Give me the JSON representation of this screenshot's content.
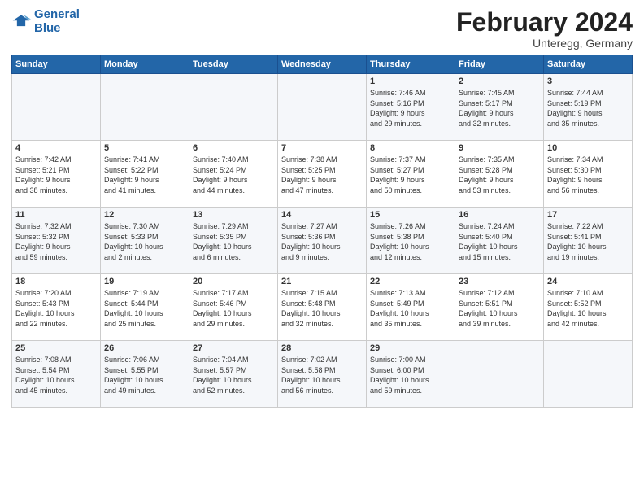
{
  "header": {
    "logo_line1": "General",
    "logo_line2": "Blue",
    "month_title": "February 2024",
    "subtitle": "Unteregg, Germany"
  },
  "days_of_week": [
    "Sunday",
    "Monday",
    "Tuesday",
    "Wednesday",
    "Thursday",
    "Friday",
    "Saturday"
  ],
  "weeks": [
    [
      {
        "day": "",
        "info": ""
      },
      {
        "day": "",
        "info": ""
      },
      {
        "day": "",
        "info": ""
      },
      {
        "day": "",
        "info": ""
      },
      {
        "day": "1",
        "info": "Sunrise: 7:46 AM\nSunset: 5:16 PM\nDaylight: 9 hours\nand 29 minutes."
      },
      {
        "day": "2",
        "info": "Sunrise: 7:45 AM\nSunset: 5:17 PM\nDaylight: 9 hours\nand 32 minutes."
      },
      {
        "day": "3",
        "info": "Sunrise: 7:44 AM\nSunset: 5:19 PM\nDaylight: 9 hours\nand 35 minutes."
      }
    ],
    [
      {
        "day": "4",
        "info": "Sunrise: 7:42 AM\nSunset: 5:21 PM\nDaylight: 9 hours\nand 38 minutes."
      },
      {
        "day": "5",
        "info": "Sunrise: 7:41 AM\nSunset: 5:22 PM\nDaylight: 9 hours\nand 41 minutes."
      },
      {
        "day": "6",
        "info": "Sunrise: 7:40 AM\nSunset: 5:24 PM\nDaylight: 9 hours\nand 44 minutes."
      },
      {
        "day": "7",
        "info": "Sunrise: 7:38 AM\nSunset: 5:25 PM\nDaylight: 9 hours\nand 47 minutes."
      },
      {
        "day": "8",
        "info": "Sunrise: 7:37 AM\nSunset: 5:27 PM\nDaylight: 9 hours\nand 50 minutes."
      },
      {
        "day": "9",
        "info": "Sunrise: 7:35 AM\nSunset: 5:28 PM\nDaylight: 9 hours\nand 53 minutes."
      },
      {
        "day": "10",
        "info": "Sunrise: 7:34 AM\nSunset: 5:30 PM\nDaylight: 9 hours\nand 56 minutes."
      }
    ],
    [
      {
        "day": "11",
        "info": "Sunrise: 7:32 AM\nSunset: 5:32 PM\nDaylight: 9 hours\nand 59 minutes."
      },
      {
        "day": "12",
        "info": "Sunrise: 7:30 AM\nSunset: 5:33 PM\nDaylight: 10 hours\nand 2 minutes."
      },
      {
        "day": "13",
        "info": "Sunrise: 7:29 AM\nSunset: 5:35 PM\nDaylight: 10 hours\nand 6 minutes."
      },
      {
        "day": "14",
        "info": "Sunrise: 7:27 AM\nSunset: 5:36 PM\nDaylight: 10 hours\nand 9 minutes."
      },
      {
        "day": "15",
        "info": "Sunrise: 7:26 AM\nSunset: 5:38 PM\nDaylight: 10 hours\nand 12 minutes."
      },
      {
        "day": "16",
        "info": "Sunrise: 7:24 AM\nSunset: 5:40 PM\nDaylight: 10 hours\nand 15 minutes."
      },
      {
        "day": "17",
        "info": "Sunrise: 7:22 AM\nSunset: 5:41 PM\nDaylight: 10 hours\nand 19 minutes."
      }
    ],
    [
      {
        "day": "18",
        "info": "Sunrise: 7:20 AM\nSunset: 5:43 PM\nDaylight: 10 hours\nand 22 minutes."
      },
      {
        "day": "19",
        "info": "Sunrise: 7:19 AM\nSunset: 5:44 PM\nDaylight: 10 hours\nand 25 minutes."
      },
      {
        "day": "20",
        "info": "Sunrise: 7:17 AM\nSunset: 5:46 PM\nDaylight: 10 hours\nand 29 minutes."
      },
      {
        "day": "21",
        "info": "Sunrise: 7:15 AM\nSunset: 5:48 PM\nDaylight: 10 hours\nand 32 minutes."
      },
      {
        "day": "22",
        "info": "Sunrise: 7:13 AM\nSunset: 5:49 PM\nDaylight: 10 hours\nand 35 minutes."
      },
      {
        "day": "23",
        "info": "Sunrise: 7:12 AM\nSunset: 5:51 PM\nDaylight: 10 hours\nand 39 minutes."
      },
      {
        "day": "24",
        "info": "Sunrise: 7:10 AM\nSunset: 5:52 PM\nDaylight: 10 hours\nand 42 minutes."
      }
    ],
    [
      {
        "day": "25",
        "info": "Sunrise: 7:08 AM\nSunset: 5:54 PM\nDaylight: 10 hours\nand 45 minutes."
      },
      {
        "day": "26",
        "info": "Sunrise: 7:06 AM\nSunset: 5:55 PM\nDaylight: 10 hours\nand 49 minutes."
      },
      {
        "day": "27",
        "info": "Sunrise: 7:04 AM\nSunset: 5:57 PM\nDaylight: 10 hours\nand 52 minutes."
      },
      {
        "day": "28",
        "info": "Sunrise: 7:02 AM\nSunset: 5:58 PM\nDaylight: 10 hours\nand 56 minutes."
      },
      {
        "day": "29",
        "info": "Sunrise: 7:00 AM\nSunset: 6:00 PM\nDaylight: 10 hours\nand 59 minutes."
      },
      {
        "day": "",
        "info": ""
      },
      {
        "day": "",
        "info": ""
      }
    ]
  ]
}
